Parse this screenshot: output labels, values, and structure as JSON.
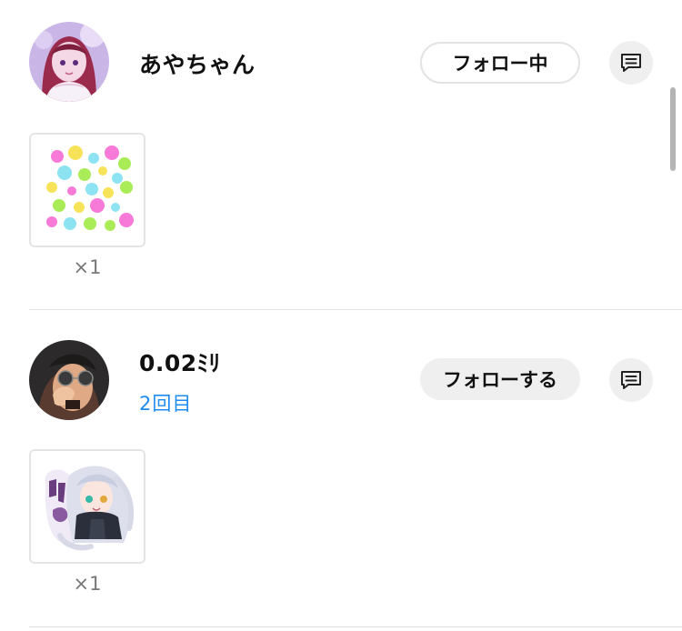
{
  "entries": [
    {
      "username": "あやちゃん",
      "visit_count": "",
      "follow_label": "フォロー中",
      "follow_state": "following",
      "gift_qty": "×1",
      "avatar_icon": "avatar-girl-icon",
      "gift_icon": "hearts-sticker-icon"
    },
    {
      "username": "0.02ﾐﾘ",
      "visit_count": "2回目",
      "follow_label": "フォローする",
      "follow_state": "not-following",
      "gift_qty": "×1",
      "avatar_icon": "avatar-sunglasses-icon",
      "gift_icon": "chibi-sticker-icon"
    }
  ],
  "colors": {
    "accent_link": "#1d8cf0",
    "button_bg": "#efefef",
    "border": "#e3e3e3",
    "divider": "#e2e2e2"
  }
}
